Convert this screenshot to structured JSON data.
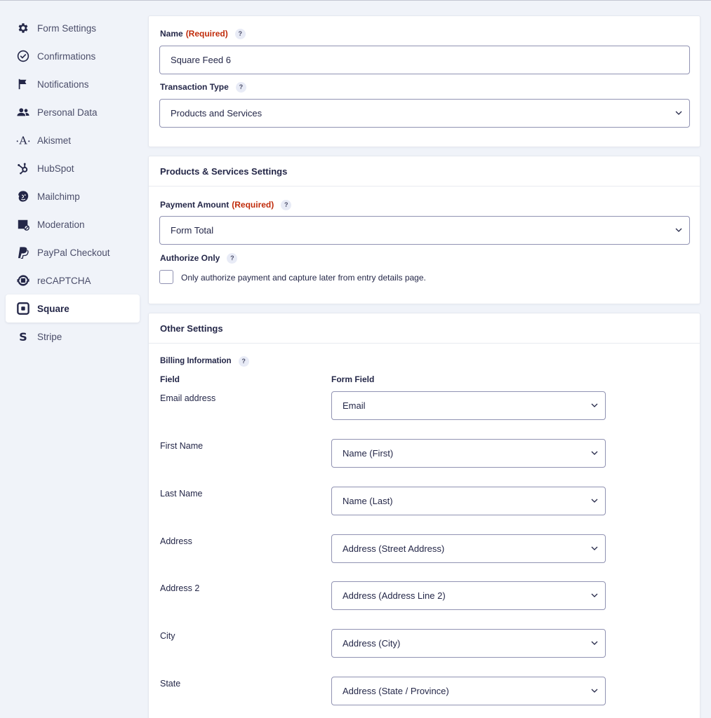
{
  "sidebar": {
    "items": [
      {
        "label": "Form Settings",
        "icon": "gear-icon"
      },
      {
        "label": "Confirmations",
        "icon": "check-circle-icon"
      },
      {
        "label": "Notifications",
        "icon": "flag-icon"
      },
      {
        "label": "Personal Data",
        "icon": "users-icon"
      },
      {
        "label": "Akismet",
        "icon": "akismet-icon"
      },
      {
        "label": "HubSpot",
        "icon": "hubspot-icon"
      },
      {
        "label": "Mailchimp",
        "icon": "mailchimp-icon"
      },
      {
        "label": "Moderation",
        "icon": "moderation-icon"
      },
      {
        "label": "PayPal Checkout",
        "icon": "paypal-icon"
      },
      {
        "label": "reCAPTCHA",
        "icon": "recaptcha-icon"
      },
      {
        "label": "Square",
        "icon": "square-icon",
        "active": true
      },
      {
        "label": "Stripe",
        "icon": "stripe-icon"
      }
    ]
  },
  "feed": {
    "name_label": "Name",
    "required_text": "(Required)",
    "help_glyph": "?",
    "name_value": "Square Feed 6",
    "transaction_type_label": "Transaction Type",
    "transaction_type_value": "Products and Services"
  },
  "products": {
    "title": "Products & Services Settings",
    "payment_amount_label": "Payment Amount",
    "payment_amount_value": "Form Total",
    "authorize_only_label": "Authorize Only",
    "authorize_only_text": "Only authorize payment and capture later from entry details page.",
    "authorize_only_checked": false
  },
  "other": {
    "title": "Other Settings",
    "billing_label": "Billing Information",
    "col_field": "Field",
    "col_form_field": "Form Field",
    "rows": [
      {
        "field": "Email address",
        "value": "Email"
      },
      {
        "field": "First Name",
        "value": "Name (First)"
      },
      {
        "field": "Last Name",
        "value": "Name (Last)"
      },
      {
        "field": "Address",
        "value": "Address (Street Address)"
      },
      {
        "field": "Address 2",
        "value": "Address (Address Line 2)"
      },
      {
        "field": "City",
        "value": "Address (City)"
      },
      {
        "field": "State",
        "value": "Address (State / Province)"
      }
    ]
  },
  "colors": {
    "required": "#c02b0a",
    "background": "#f0f3f9",
    "text": "#242748",
    "border": "#9092b2"
  }
}
